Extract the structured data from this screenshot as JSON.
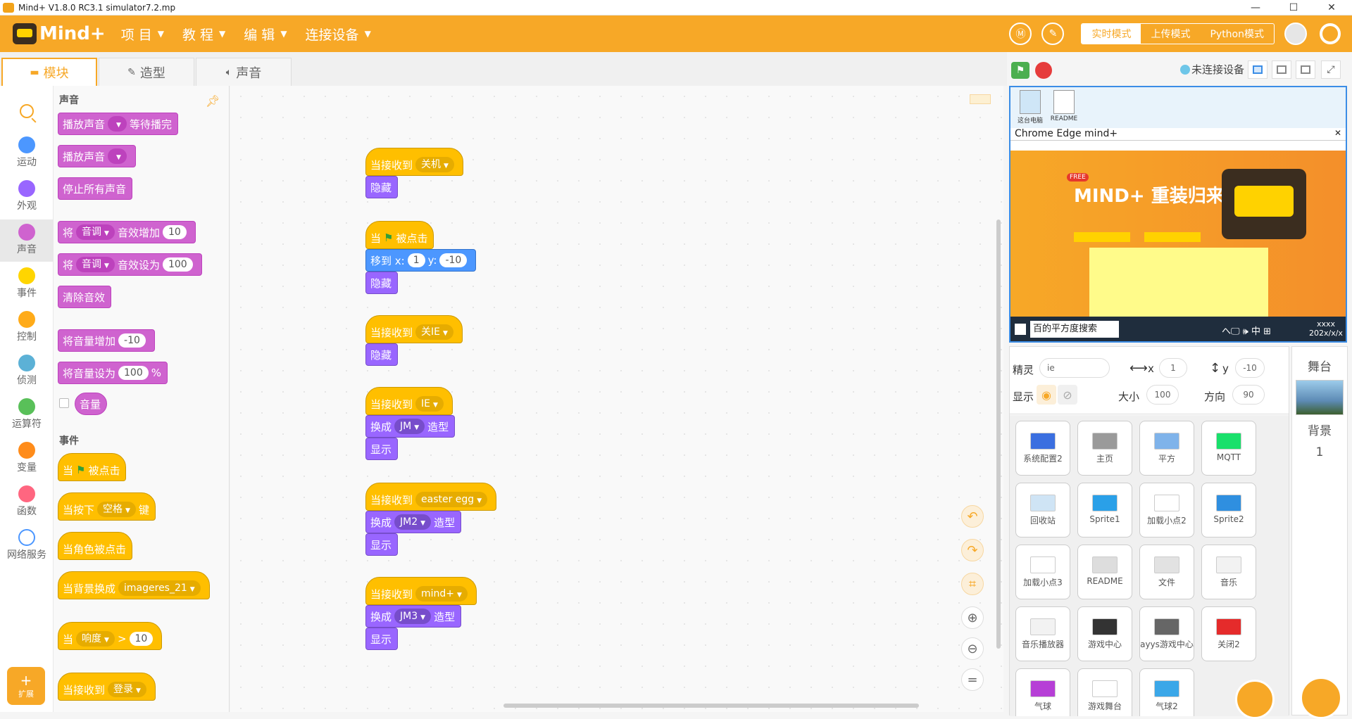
{
  "titlebar": {
    "title": "Mind+ V1.8.0 RC3.1   simulator7.2.mp",
    "minimize": "—",
    "maximize": "☐",
    "close": "✕"
  },
  "header": {
    "logo": "Mind+",
    "menu": [
      {
        "label": "项 目"
      },
      {
        "label": "教 程"
      },
      {
        "label": "编 辑"
      },
      {
        "label": "连接设备"
      }
    ],
    "modes": {
      "realtime": "实时模式",
      "upload": "上传模式",
      "python": "Python模式"
    },
    "accent": "#f7a827"
  },
  "tabs": {
    "blocks": "模块",
    "costumes": "造型",
    "sounds": "声音"
  },
  "stage_toolbar": {
    "status": "未连接设备"
  },
  "categories": [
    {
      "label": "运动",
      "color": "#4c97ff"
    },
    {
      "label": "外观",
      "color": "#9966ff"
    },
    {
      "label": "声音",
      "color": "#cf63cf"
    },
    {
      "label": "事件",
      "color": "#ffd500"
    },
    {
      "label": "控制",
      "color": "#ffab19"
    },
    {
      "label": "侦测",
      "color": "#5cb1d6"
    },
    {
      "label": "运算符",
      "color": "#59c059"
    },
    {
      "label": "变量",
      "color": "#ff8c1a"
    },
    {
      "label": "函数",
      "color": "#ff6680"
    },
    {
      "label": "网络服务",
      "color": "#4c97ff"
    }
  ],
  "extension": {
    "label": "扩展",
    "plus": "+"
  },
  "palette": {
    "sound_heading": "声音",
    "events_heading": "事件",
    "b_play_until": "播放声音",
    "b_play_until_tail": "等待播完",
    "b_play": "播放声音",
    "b_stop_all": "停止所有声音",
    "b_jiang": "将",
    "b_pitch": "音调",
    "b_effect_change": "音效增加",
    "b_effect_change_val": "10",
    "b_effect_set": "音效设为",
    "b_effect_set_val": "100",
    "b_clear_effects": "清除音效",
    "b_vol_change": "将音量增加",
    "b_vol_change_val": "-10",
    "b_vol_set": "将音量设为",
    "b_vol_set_val": "100",
    "b_percent": "%",
    "b_volume": "音量",
    "e_when": "当",
    "e_clicked": "被点击",
    "e_key": "当按下",
    "e_space": "空格",
    "e_key_tail": "键",
    "e_sprite_clicked": "当角色被点击",
    "e_backdrop": "当背景换成",
    "e_backdrop_val": "imageres_21",
    "e_loudness": "响度",
    "e_gt": ">",
    "e_loud_val": "10",
    "e_receive": "当接收到",
    "e_receive_val": "登录"
  },
  "script": {
    "recv": "当接收到",
    "hide": "隐藏",
    "show": "显示",
    "switch": "换成",
    "costume_suffix": "造型",
    "when": "当",
    "clicked": "被点击",
    "goto": "移到 x:",
    "goto_y": "y:",
    "x_val": "1",
    "y_val": "-10",
    "msg_shutdown": "关机",
    "msg_close_ie": "关IE",
    "msg_ie": "IE",
    "msg_easter": "easter egg",
    "msg_mind": "mind+",
    "c_jm": "JM",
    "c_jm2": "JM2",
    "c_jm3": "JM3"
  },
  "stage": {
    "desk_pc": "这台电脑",
    "desk_readme": "README",
    "browser": "Chrome Edge  mind+",
    "close": "✕",
    "free": "FREE",
    "headline": "MIND+ 重装归来",
    "search": "百的平方度搜索",
    "tray": "へ🖵 🕪 中 ⊞",
    "clock_time": "xxxx",
    "clock_date": "202x/x/x"
  },
  "sprite_info": {
    "sprite_label": "精灵",
    "sprite_name": "ie",
    "x_label": "x",
    "x_val": "1",
    "y_label": "y",
    "y_val": "-10",
    "show_label": "显示",
    "size_label": "大小",
    "size_val": "100",
    "dir_label": "方向",
    "dir_val": "90"
  },
  "sprites": [
    {
      "name": "系统配置2",
      "color": "#3b6fe0"
    },
    {
      "name": "主页",
      "color": "#9a9a9a"
    },
    {
      "name": "平方",
      "color": "#7fb3ea"
    },
    {
      "name": "MQTT",
      "color": "#19e06b"
    },
    {
      "name": "回收站",
      "color": "#cfe4f5"
    },
    {
      "name": "Sprite1",
      "color": "#2aa0e8"
    },
    {
      "name": "加载小点2",
      "color": "#ffffff"
    },
    {
      "name": "Sprite2",
      "color": "#2f8fe0"
    },
    {
      "name": "加载小点3",
      "color": "#ffffff"
    },
    {
      "name": "README",
      "color": "#dddddd"
    },
    {
      "name": "文件",
      "color": "#e2e2e2"
    },
    {
      "name": "音乐",
      "color": "#f2f2f2"
    },
    {
      "name": "音乐播放器",
      "color": "#f2f2f2"
    },
    {
      "name": "游戏中心",
      "color": "#333333"
    },
    {
      "name": "ayys游戏中心",
      "color": "#666666"
    },
    {
      "name": "关闭2",
      "color": "#e52b2b"
    },
    {
      "name": "气球",
      "color": "#b63fd6"
    },
    {
      "name": "游戏舞台",
      "color": "#ffffff"
    },
    {
      "name": "气球2",
      "color": "#3ba7e8"
    }
  ],
  "stage_panel": {
    "title": "舞台",
    "backdrop_label": "背景",
    "backdrop_count": "1"
  }
}
